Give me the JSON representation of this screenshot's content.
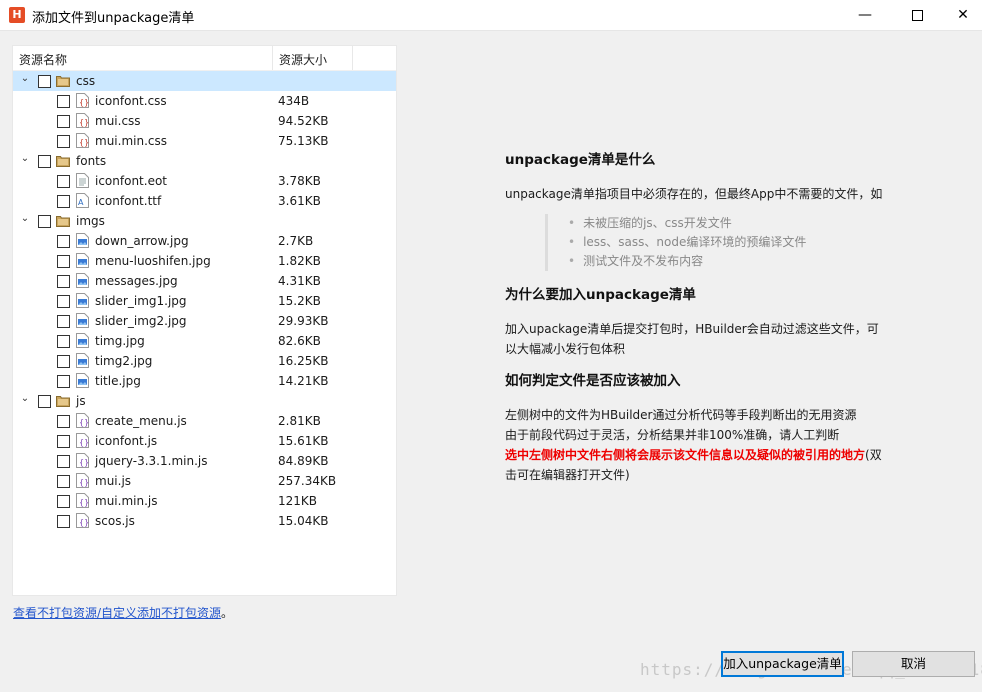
{
  "window": {
    "title": "添加文件到unpackage清单",
    "minimize": "—",
    "close": "✕"
  },
  "tree": {
    "columns": {
      "name": "资源名称",
      "size": "资源大小"
    },
    "rows": [
      {
        "kind": "folder",
        "name": "css",
        "size": "",
        "expanded": true,
        "selected": true
      },
      {
        "kind": "file",
        "name": "iconfont.css",
        "size": "434B",
        "icon": "css"
      },
      {
        "kind": "file",
        "name": "mui.css",
        "size": "94.52KB",
        "icon": "css"
      },
      {
        "kind": "file",
        "name": "mui.min.css",
        "size": "75.13KB",
        "icon": "css"
      },
      {
        "kind": "folder",
        "name": "fonts",
        "size": "",
        "expanded": true
      },
      {
        "kind": "file",
        "name": "iconfont.eot",
        "size": "3.78KB",
        "icon": "doc"
      },
      {
        "kind": "file",
        "name": "iconfont.ttf",
        "size": "3.61KB",
        "icon": "font"
      },
      {
        "kind": "folder",
        "name": "imgs",
        "size": "",
        "expanded": true
      },
      {
        "kind": "file",
        "name": "down_arrow.jpg",
        "size": "2.7KB",
        "icon": "img"
      },
      {
        "kind": "file",
        "name": "menu-luoshifen.jpg",
        "size": "1.82KB",
        "icon": "img"
      },
      {
        "kind": "file",
        "name": "messages.jpg",
        "size": "4.31KB",
        "icon": "img"
      },
      {
        "kind": "file",
        "name": "slider_img1.jpg",
        "size": "15.2KB",
        "icon": "img"
      },
      {
        "kind": "file",
        "name": "slider_img2.jpg",
        "size": "29.93KB",
        "icon": "img"
      },
      {
        "kind": "file",
        "name": "timg.jpg",
        "size": "82.6KB",
        "icon": "img"
      },
      {
        "kind": "file",
        "name": "timg2.jpg",
        "size": "16.25KB",
        "icon": "img"
      },
      {
        "kind": "file",
        "name": "title.jpg",
        "size": "14.21KB",
        "icon": "img"
      },
      {
        "kind": "folder",
        "name": "js",
        "size": "",
        "expanded": true
      },
      {
        "kind": "file",
        "name": "create_menu.js",
        "size": "2.81KB",
        "icon": "js"
      },
      {
        "kind": "file",
        "name": "iconfont.js",
        "size": "15.61KB",
        "icon": "js"
      },
      {
        "kind": "file",
        "name": "jquery-3.3.1.min.js",
        "size": "84.89KB",
        "icon": "js"
      },
      {
        "kind": "file",
        "name": "mui.js",
        "size": "257.34KB",
        "icon": "js"
      },
      {
        "kind": "file",
        "name": "mui.min.js",
        "size": "121KB",
        "icon": "js"
      },
      {
        "kind": "file",
        "name": "scos.js",
        "size": "15.04KB",
        "icon": "js"
      }
    ]
  },
  "info": {
    "heading1": "unpackage清单是什么",
    "para1": "unpackage清单指项目中必须存在的，但最终App中不需要的文件，如",
    "bullets": [
      "未被压缩的js、css开发文件",
      "less、sass、node编译环境的预编译文件",
      "测试文件及不发布内容"
    ],
    "heading2": "为什么要加入unpackage清单",
    "para2": "加入upackage清单后提交打包时，HBuilder会自动过滤这些文件，可以大幅减小发行包体积",
    "heading3": "如何判定文件是否应该被加入",
    "para3a": "左侧树中的文件为HBuilder通过分析代码等手段判断出的无用资源",
    "para3b": "由于前段代码过于灵活，分析结果并非100%准确，请人工判断",
    "para3_red": "选中左侧树中文件右侧将会展示该文件信息以及疑似的被引用的地方",
    "para3_tail": "(双击可在编辑器打开文件)"
  },
  "footer": {
    "link": "查看不打包资源/自定义添加不打包资源",
    "period": "。",
    "primary_button": "加入unpackage清单",
    "cancel_button": "取消",
    "watermark": "https://blog.csdn.net/qq_40127318"
  },
  "colors": {
    "selected_row": "#cce8ff",
    "link": "#2255cc",
    "emphasis": "#ee0000",
    "accent": "#0078d7"
  }
}
